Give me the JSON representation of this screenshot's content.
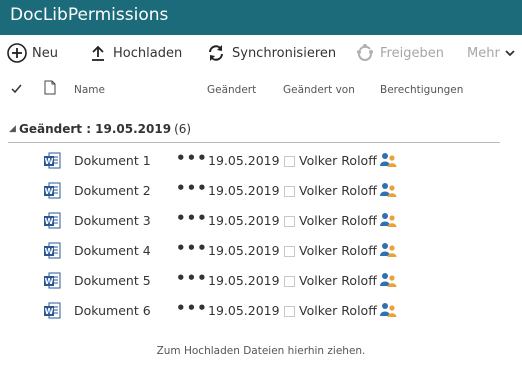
{
  "app": {
    "title": "DocLibPermissions",
    "accent": "#1b6b7a"
  },
  "toolbar": {
    "new_label": "Neu",
    "upload_label": "Hochladen",
    "sync_label": "Synchronisieren",
    "share_label": "Freigeben",
    "more_label": "Mehr"
  },
  "columns": {
    "name": "Name",
    "modified": "Geändert",
    "modified_by": "Geändert von",
    "permissions": "Berechtigungen"
  },
  "group": {
    "label": "Geändert : 19.05.2019",
    "count": "(6)"
  },
  "rows": [
    {
      "name": "Dokument 1",
      "modified": "19.05.2019",
      "modified_by": "Volker Roloff",
      "icon": "word-doc-icon",
      "perm_icon": "permissions-people-icon"
    },
    {
      "name": "Dokument 2",
      "modified": "19.05.2019",
      "modified_by": "Volker Roloff",
      "icon": "word-doc-icon",
      "perm_icon": "permissions-people-icon"
    },
    {
      "name": "Dokument 3",
      "modified": "19.05.2019",
      "modified_by": "Volker Roloff",
      "icon": "word-doc-icon",
      "perm_icon": "permissions-people-edit-icon"
    },
    {
      "name": "Dokument 4",
      "modified": "19.05.2019",
      "modified_by": "Volker Roloff",
      "icon": "word-doc-icon",
      "perm_icon": "permissions-people-icon"
    },
    {
      "name": "Dokument 5",
      "modified": "19.05.2019",
      "modified_by": "Volker Roloff",
      "icon": "word-doc-icon",
      "perm_icon": "permissions-people-icon"
    },
    {
      "name": "Dokument 6",
      "modified": "19.05.2019",
      "modified_by": "Volker Roloff",
      "icon": "word-doc-icon",
      "perm_icon": "permissions-people-icon"
    }
  ],
  "footer": {
    "drop_hint": "Zum Hochladen Dateien hierhin ziehen."
  }
}
